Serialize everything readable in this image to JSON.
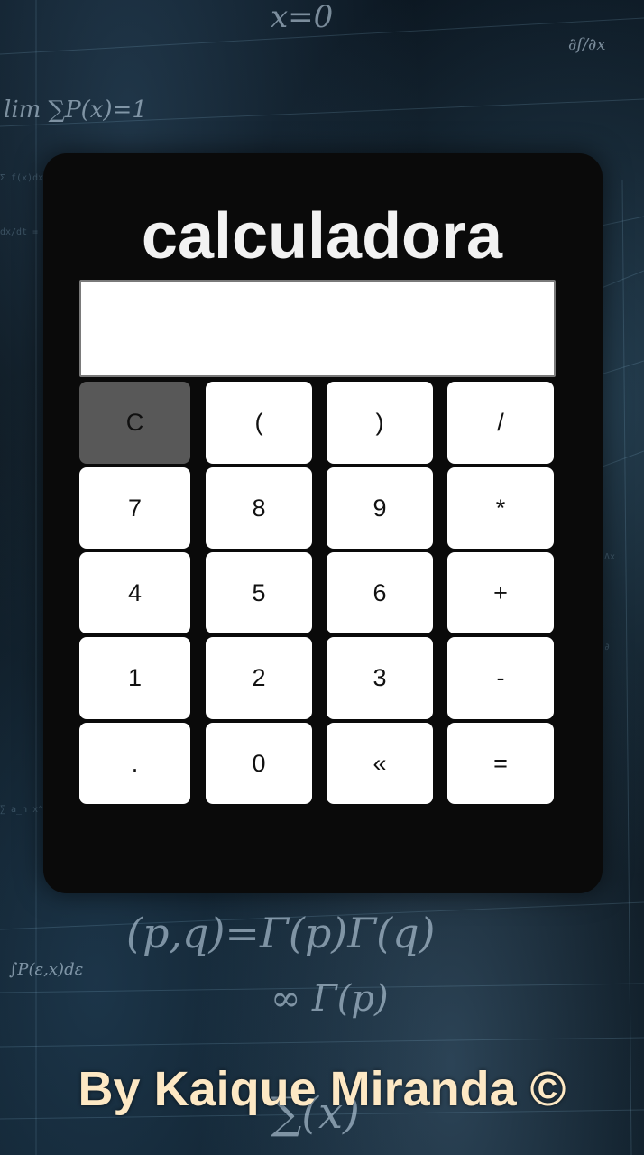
{
  "header": {
    "title": "calculadora"
  },
  "display": {
    "value": ""
  },
  "keypad": {
    "clear": "C",
    "open_paren": "(",
    "close_paren": ")",
    "divide": "/",
    "seven": "7",
    "eight": "8",
    "nine": "9",
    "multiply": "*",
    "four": "4",
    "five": "5",
    "six": "6",
    "plus": "+",
    "one": "1",
    "two": "2",
    "three": "3",
    "minus": "-",
    "decimal": ".",
    "zero": "0",
    "backspace": "«",
    "equals": "="
  },
  "footer": {
    "credit": "By Kaique Miranda ©"
  },
  "colors": {
    "panel": "#0a0a0a",
    "key": "#ffffff",
    "clear_key": "#585858",
    "title": "#f2f2f2",
    "footer_text": "#fde8c4"
  }
}
